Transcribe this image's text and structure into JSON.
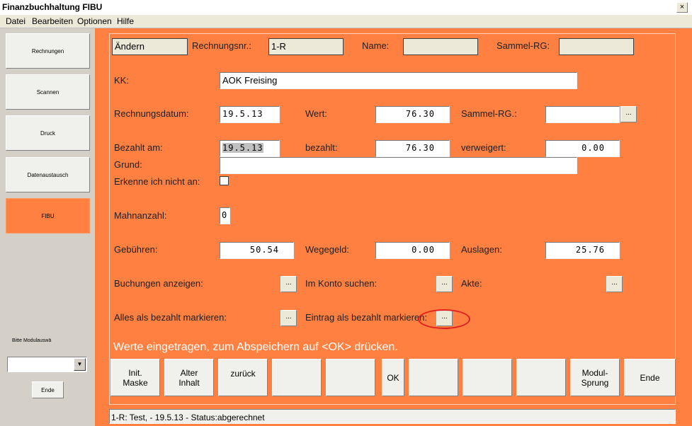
{
  "window": {
    "title": "Finanzbuchhaltung FIBU",
    "close_glyph": "×"
  },
  "menu": {
    "items": [
      "Datei",
      "Bearbeiten",
      "Optionen",
      "Hilfe"
    ]
  },
  "sidebar": {
    "items": [
      {
        "label": "Rechnungen"
      },
      {
        "label": "Scannen"
      },
      {
        "label": "Druck"
      },
      {
        "label": "Datenaustausch"
      },
      {
        "label": "FIBU",
        "active": true
      }
    ],
    "module_hint": "Bitte Modulauswä",
    "module_select_value": "",
    "ende_label": "Ende"
  },
  "form": {
    "mode_value": "Ändern",
    "rechnungsnr": {
      "label": "Rechnungsnr.:",
      "value": "1-R"
    },
    "name": {
      "label": "Name:",
      "value": ""
    },
    "sammel_rg_top": {
      "label": "Sammel-RG:",
      "value": ""
    },
    "kk": {
      "label": "KK:",
      "value": "AOK Freising"
    },
    "rechnungsdatum": {
      "label": "Rechnungsdatum:",
      "value": "19.5.13"
    },
    "wert": {
      "label": "Wert:",
      "value": "76.30"
    },
    "sammel_rg": {
      "label": "Sammel-RG.:",
      "value": ""
    },
    "bezahlt_am": {
      "label": "Bezahlt am:",
      "value": "19.5.13"
    },
    "bezahlt": {
      "label": "bezahlt:",
      "value": "76.30"
    },
    "verweigert": {
      "label": "verweigert:",
      "value": "0.00"
    },
    "grund": {
      "label": "Grund:",
      "value": ""
    },
    "erkenne": {
      "label": "Erkenne ich nicht an:",
      "checked": false
    },
    "mahnanzahl": {
      "label": "Mahnanzahl:",
      "value": "0"
    },
    "gebuehren": {
      "label": "Gebühren:",
      "value": "50.54"
    },
    "wegegeld": {
      "label": "Wegegeld:",
      "value": "0.00"
    },
    "auslagen": {
      "label": "Auslagen:",
      "value": "25.76"
    },
    "buchungen": {
      "label": "Buchungen anzeigen:"
    },
    "konto": {
      "label": "Im Konto suchen:"
    },
    "akte": {
      "label": "Akte:"
    },
    "alles_bezahlt": {
      "label": "Alles als bezahlt markieren:"
    },
    "eintrag_bezahlt": {
      "label": "Eintrag als bezahlt markieren:"
    },
    "dots_label": "..."
  },
  "message": "Werte eingetragen, zum Abspeichern auf <OK> drücken.",
  "footer_buttons": [
    "Init.\nMaske",
    "Alter\nInhalt",
    "zurück",
    "",
    "",
    "OK",
    "",
    "",
    "",
    "Modul-\nSprung",
    "Ende"
  ],
  "status_bar": "1-R: Test,  - 19.5.13 - Status:abgerechnet",
  "colors": {
    "panel": "#ff8040",
    "highlight": "#e02020"
  }
}
